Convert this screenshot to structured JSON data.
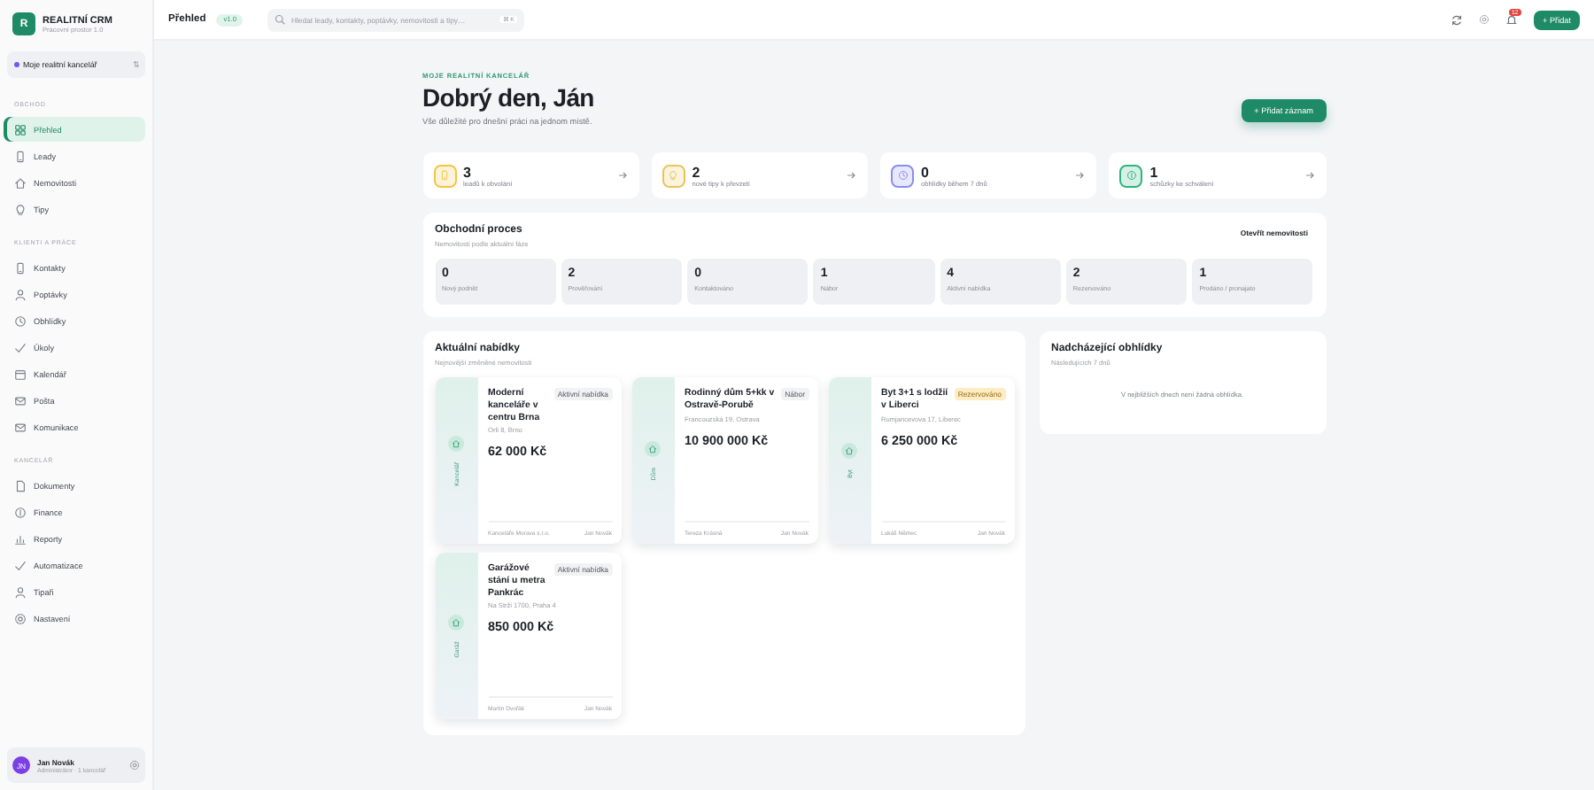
{
  "sidebar": {
    "logo": "R",
    "title": "REALITNÍ CRM",
    "subtitle": "Pracovní prostor 1.0",
    "workspace": {
      "label": "Moje realitní kancelář",
      "shortcut": "⇅"
    },
    "sections": [
      {
        "heading": "OBCHOD",
        "items": [
          {
            "label": "Přehled",
            "selected": true
          },
          {
            "label": "Leady",
            "selected": false
          },
          {
            "label": "Nemovitosti",
            "selected": false
          },
          {
            "label": "Tipy",
            "selected": false
          }
        ]
      },
      {
        "heading": "KLIENTI A PRÁCE",
        "items": [
          {
            "label": "Kontakty",
            "selected": false
          },
          {
            "label": "Poptávky",
            "selected": false
          },
          {
            "label": "Obhlídky",
            "selected": false
          },
          {
            "label": "Úkoly",
            "selected": false
          },
          {
            "label": "Kalendář",
            "selected": false
          },
          {
            "label": "Pošta",
            "selected": false
          },
          {
            "label": "Komunikace",
            "selected": false
          }
        ]
      },
      {
        "heading": "KANCELÁŘ",
        "items": [
          {
            "label": "Dokumenty",
            "selected": false
          },
          {
            "label": "Finance",
            "selected": false
          },
          {
            "label": "Reporty",
            "selected": false
          },
          {
            "label": "Automatizace",
            "selected": false
          },
          {
            "label": "Tipaři",
            "selected": false
          },
          {
            "label": "Nastavení",
            "selected": false
          }
        ]
      }
    ],
    "user": {
      "initials": "JN",
      "name": "Jan Novák",
      "role": "Administrátor · 1 kancelář"
    }
  },
  "topbar": {
    "title": "Přehled",
    "version": "v1.0",
    "search": {
      "placeholder": "Hledat leady, kontakty, poptávky, nemovitosti a tipy…",
      "shortcut": "⌘K"
    },
    "notifications": "12",
    "add_button": "+ Přidat"
  },
  "hero": {
    "eyebrow": "MOJE REALITNÍ KANCELÁŘ",
    "greeting": "Dobrý den, Ján",
    "subtitle": "Vše důležité pro dnešní práci na jednom místě.",
    "button": "+ Přidat záznam"
  },
  "stats": [
    {
      "value": "3",
      "label": "leadů k obvolání",
      "color": "#f4c542"
    },
    {
      "value": "2",
      "label": "nové tipy k převzetí",
      "color": "#e8c45a"
    },
    {
      "value": "0",
      "label": "obhlídky během 7 dnů",
      "color": "#8b8cf0"
    },
    {
      "value": "1",
      "label": "schůzky ke schválení",
      "color": "#2fb37f"
    }
  ],
  "pipeline": {
    "title": "Obchodní proces",
    "subtitle": "Nemovitosti podle aktuální fáze",
    "link": "Otevřít nemovitosti",
    "stages": [
      {
        "value": "0",
        "label": "Nový podnět"
      },
      {
        "value": "2",
        "label": "Prověřování"
      },
      {
        "value": "0",
        "label": "Kontaktováno"
      },
      {
        "value": "1",
        "label": "Nábor"
      },
      {
        "value": "4",
        "label": "Aktivní nabídka"
      },
      {
        "value": "2",
        "label": "Rezervováno"
      },
      {
        "value": "1",
        "label": "Prodáno / pronajato"
      }
    ]
  },
  "offers": {
    "title": "Aktuální nabídky",
    "subtitle": "Nejnovější změněné nemovitosti",
    "items": [
      {
        "type": "Kancelář",
        "title": "Moderní kanceláře v centru Brna",
        "badge": "Aktivní nabídka",
        "color": "#f1f2f4",
        "address": "Orlí 8, Brno",
        "price": "62 000 Kč",
        "agency": "Kanceláře Morava s.r.o.",
        "agent": "Jan Novák"
      },
      {
        "type": "Dům",
        "title": "Rodinný dům 5+kk v Ostravě-Porubě",
        "badge": "Nábor",
        "color": "#f1f2f4",
        "address": "Francouzská 19, Ostrava",
        "price": "10 900 000 Kč",
        "agency": "Tereza Krásná",
        "agent": "Jan Novák"
      },
      {
        "type": "Byt",
        "title": "Byt 3+1 s lodžií v Liberci",
        "badge": "Rezervováno",
        "color": "#fdecc4",
        "address": "Rumjancevova 17, Liberec",
        "price": "6 250 000 Kč",
        "agency": "Lukáš Němec",
        "agent": "Jan Novák"
      },
      {
        "type": "Garáž",
        "title": "Garážové stání u metra Pankrác",
        "badge": "Aktivní nabídka",
        "color": "#f1f2f4",
        "address": "Na Strži 1700, Praha 4",
        "price": "850 000 Kč",
        "agency": "Martin Dvořák",
        "agent": "Jan Novák"
      }
    ]
  },
  "upcoming": {
    "title": "Nadcházející obhlídky",
    "subtitle": "Následujících 7 dnů",
    "empty": "V nejbližších dnech není žádná obhlídka."
  }
}
